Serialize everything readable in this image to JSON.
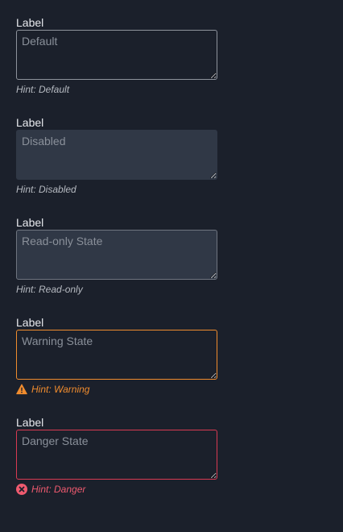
{
  "fields": [
    {
      "label": "Label",
      "placeholder": "Default",
      "hint": "Hint: Default"
    },
    {
      "label": "Label",
      "placeholder": "Disabled",
      "hint": "Hint: Disabled"
    },
    {
      "label": "Label",
      "placeholder": "Read-only State",
      "hint": "Hint: Read-only"
    },
    {
      "label": "Label",
      "placeholder": "Warning State",
      "hint": "Hint: Warning",
      "icon": "warning-triangle-icon"
    },
    {
      "label": "Label",
      "placeholder": "Danger State",
      "hint": "Hint: Danger",
      "icon": "error-circle-icon"
    }
  ],
  "colors": {
    "background": "#1b202b",
    "text": "#e8eaee",
    "warning": "#f08c2e",
    "danger": "#d93a52",
    "disabled_bg": "#303846"
  }
}
